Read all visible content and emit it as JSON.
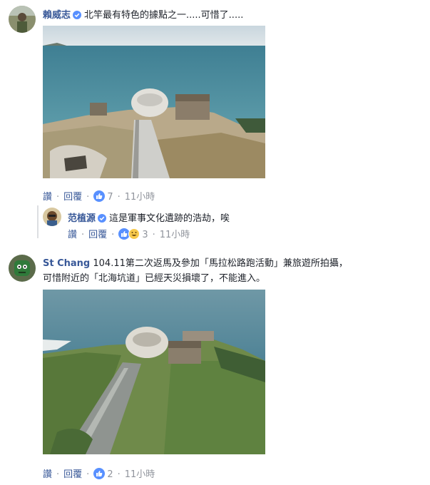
{
  "comments": [
    {
      "author": "賴威志",
      "text": "北竿最有特色的據點之一.....可惜了.....",
      "actions": {
        "like": "讚",
        "reply": "回覆",
        "reactions": "7",
        "time": "11小時"
      }
    },
    {
      "author": "范植源",
      "text": "這是軍事文化遺跡的浩劫，唉",
      "actions": {
        "like": "讚",
        "reply": "回覆",
        "reactions": "3",
        "time": "11小時"
      }
    },
    {
      "author": "St Chang",
      "text_line1": "104.11第二次返馬及參加「馬拉松路跑活動」兼旅遊所拍攝，",
      "text_line2": "可惜附近的「北海坑道」已經天災損壞了，不能進入。",
      "actions": {
        "like": "讚",
        "reply": "回覆",
        "reactions": "2",
        "time": "11小時"
      }
    }
  ],
  "colors": {
    "name": "#385898",
    "meta": "#90949c",
    "like_blue": "#5890ff",
    "haha_yellow": "#f7c94b"
  },
  "icons": [
    "verified-badge-icon",
    "like-reaction-icon",
    "haha-reaction-icon"
  ]
}
